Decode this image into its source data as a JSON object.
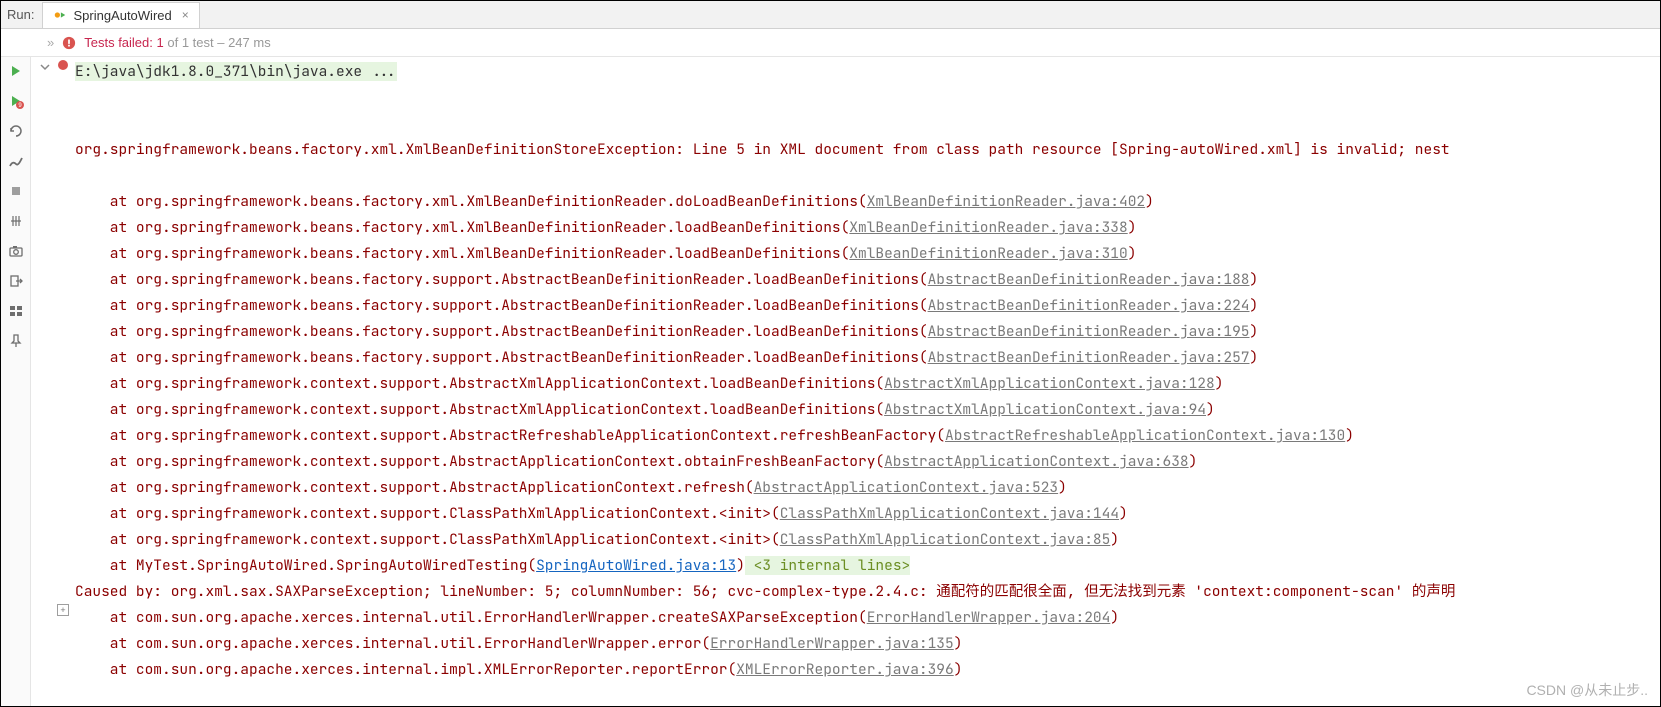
{
  "header": {
    "run_label": "Run:",
    "tab_title": "SpringAutoWired",
    "tab_close": "×"
  },
  "status": {
    "chev": "»",
    "fail_label": "Tests failed:",
    "fail_count": "1",
    "fail_rest": " of 1 test – 247 ms"
  },
  "cmd_line": "E:\\java\\jdk1.8.0_371\\bin\\java.exe ...",
  "exception_line": "org.springframework.beans.factory.xml.XmlBeanDefinitionStoreException: Line 5 in XML document from class path resource [Spring-autoWired.xml] is invalid; nest",
  "stack": [
    {
      "pre": "    at org.springframework.beans.factory.xml.XmlBeanDefinitionReader.doLoadBeanDefinitions(",
      "link": "XmlBeanDefinitionReader.java:402",
      "post": ")"
    },
    {
      "pre": "    at org.springframework.beans.factory.xml.XmlBeanDefinitionReader.loadBeanDefinitions(",
      "link": "XmlBeanDefinitionReader.java:338",
      "post": ")"
    },
    {
      "pre": "    at org.springframework.beans.factory.xml.XmlBeanDefinitionReader.loadBeanDefinitions(",
      "link": "XmlBeanDefinitionReader.java:310",
      "post": ")"
    },
    {
      "pre": "    at org.springframework.beans.factory.support.AbstractBeanDefinitionReader.loadBeanDefinitions(",
      "link": "AbstractBeanDefinitionReader.java:188",
      "post": ")"
    },
    {
      "pre": "    at org.springframework.beans.factory.support.AbstractBeanDefinitionReader.loadBeanDefinitions(",
      "link": "AbstractBeanDefinitionReader.java:224",
      "post": ")"
    },
    {
      "pre": "    at org.springframework.beans.factory.support.AbstractBeanDefinitionReader.loadBeanDefinitions(",
      "link": "AbstractBeanDefinitionReader.java:195",
      "post": ")"
    },
    {
      "pre": "    at org.springframework.beans.factory.support.AbstractBeanDefinitionReader.loadBeanDefinitions(",
      "link": "AbstractBeanDefinitionReader.java:257",
      "post": ")"
    },
    {
      "pre": "    at org.springframework.context.support.AbstractXmlApplicationContext.loadBeanDefinitions(",
      "link": "AbstractXmlApplicationContext.java:128",
      "post": ")"
    },
    {
      "pre": "    at org.springframework.context.support.AbstractXmlApplicationContext.loadBeanDefinitions(",
      "link": "AbstractXmlApplicationContext.java:94",
      "post": ")"
    },
    {
      "pre": "    at org.springframework.context.support.AbstractRefreshableApplicationContext.refreshBeanFactory(",
      "link": "AbstractRefreshableApplicationContext.java:130",
      "post": ")"
    },
    {
      "pre": "    at org.springframework.context.support.AbstractApplicationContext.obtainFreshBeanFactory(",
      "link": "AbstractApplicationContext.java:638",
      "post": ")"
    },
    {
      "pre": "    at org.springframework.context.support.AbstractApplicationContext.refresh(",
      "link": "AbstractApplicationContext.java:523",
      "post": ")"
    },
    {
      "pre": "    at org.springframework.context.support.ClassPathXmlApplicationContext.<init>(",
      "link": "ClassPathXmlApplicationContext.java:144",
      "post": ")"
    },
    {
      "pre": "    at org.springframework.context.support.ClassPathXmlApplicationContext.<init>(",
      "link": "ClassPathXmlApplicationContext.java:85",
      "post": ")"
    }
  ],
  "user_frame": {
    "pre": "    at MyTest.SpringAutoWired.SpringAutoWiredTesting(",
    "link": "SpringAutoWired.java:13",
    "post": ")",
    "fold": " <3 internal lines>"
  },
  "caused_by": "Caused by: org.xml.sax.SAXParseException; lineNumber: 5; columnNumber: 56; cvc-complex-type.2.4.c: 通配符的匹配很全面, 但无法找到元素 'context:component-scan' 的声明",
  "caused_stack": [
    {
      "pre": "    at com.sun.org.apache.xerces.internal.util.ErrorHandlerWrapper.createSAXParseException(",
      "link": "ErrorHandlerWrapper.java:204",
      "post": ")"
    },
    {
      "pre": "    at com.sun.org.apache.xerces.internal.util.ErrorHandlerWrapper.error(",
      "link": "ErrorHandlerWrapper.java:135",
      "post": ")"
    },
    {
      "pre": "    at com.sun.org.apache.xerces.internal.impl.XMLErrorReporter.reportError(",
      "link": "XMLErrorReporter.java:396",
      "post": ")"
    }
  ],
  "watermark": "CSDN @从未止步.."
}
